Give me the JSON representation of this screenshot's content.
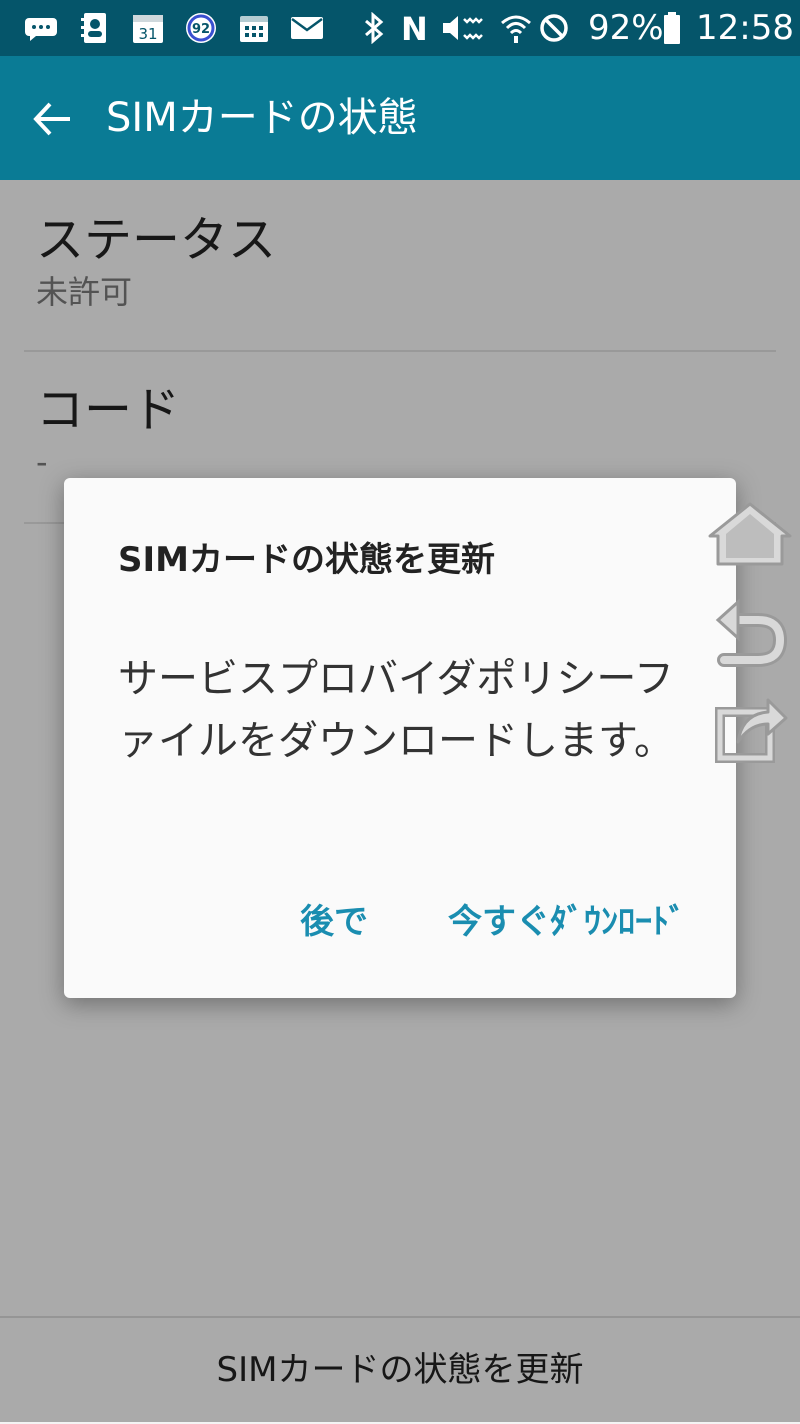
{
  "status_bar": {
    "battery_percent": "92%",
    "time": "12:58",
    "notification_badge": "92",
    "calendar_day": "31",
    "icons": [
      "message-icon",
      "contacts-icon",
      "calendar-icon",
      "data-usage-icon",
      "schedule-icon",
      "email-icon",
      "bluetooth-icon",
      "nfc-icon",
      "mute-icon",
      "wifi-icon",
      "do-not-disturb-icon",
      "battery-icon"
    ]
  },
  "app_bar": {
    "title": "SIMカードの状態",
    "color": "#0a7b95"
  },
  "settings": {
    "status_label": "ステータス",
    "status_value": "未許可",
    "code_label": "コード",
    "code_value": "-"
  },
  "bottom_bar": {
    "update_label": "SIMカードの状態を更新"
  },
  "dialog": {
    "title": "SIMカードの状態を更新",
    "message": "サービスプロバイダポリシーファイルをダウンロードします。",
    "later_label": "後で",
    "download_label": "今すぐﾀﾞｳﾝﾛｰﾄﾞ",
    "accent_color": "#1a8db0"
  },
  "floating_controls": [
    "home-icon",
    "back-icon",
    "share-icon"
  ]
}
